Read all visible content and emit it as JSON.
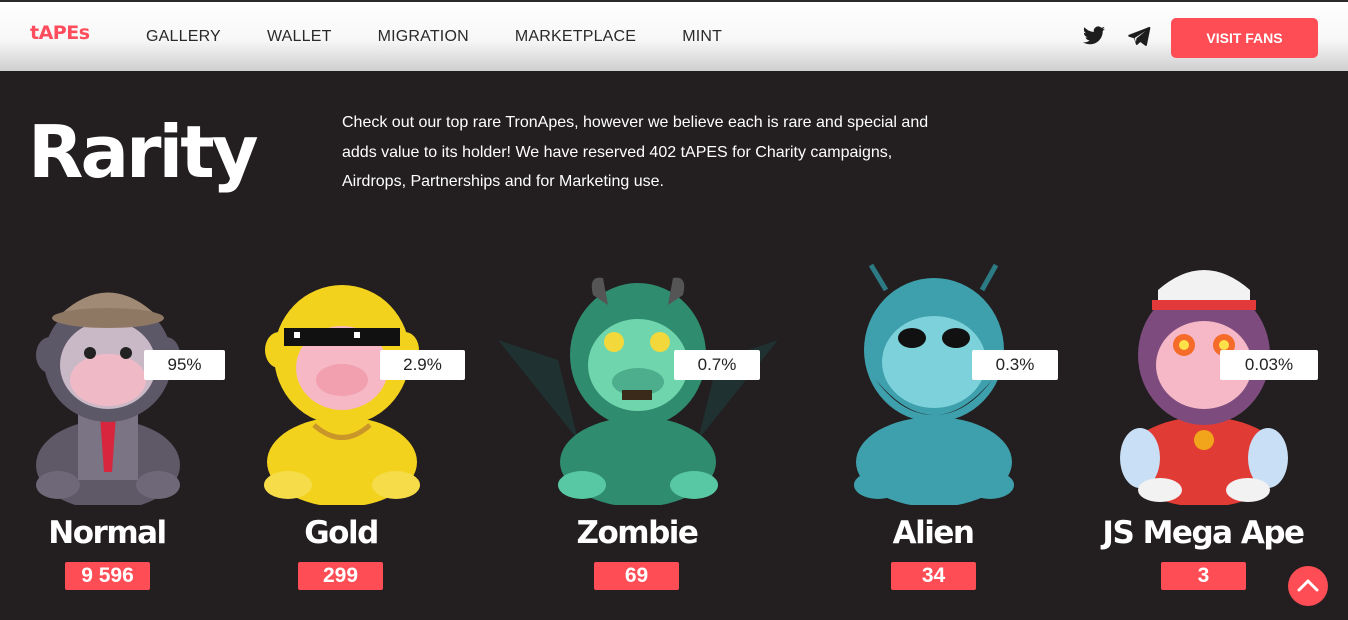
{
  "brand": {
    "logo": "tAPEs",
    "accent": "#ff4d55"
  },
  "nav": {
    "links": [
      "GALLERY",
      "WALLET",
      "MIGRATION",
      "MARKETPLACE",
      "MINT"
    ],
    "social": [
      "twitter-icon",
      "telegram-icon"
    ],
    "cta": "VISIT FANS"
  },
  "hero": {
    "title": "Rarity",
    "description": "Check out our top rare TronApes, however we believe each is rare and special and adds value to its holder! We have reserved 402 tAPES for Charity campaigns, Airdrops, Partnerships and for Marketing use."
  },
  "apes": [
    {
      "name": "Normal",
      "percent": "95%",
      "count": "9 596",
      "color": "#6f6879"
    },
    {
      "name": "Gold",
      "percent": "2.9%",
      "count": "299",
      "color": "#f3d21e"
    },
    {
      "name": "Zombie",
      "percent": "0.7%",
      "count": "69",
      "color": "#2f8c6e"
    },
    {
      "name": "Alien",
      "percent": "0.3%",
      "count": "34",
      "color": "#3ea0ac"
    },
    {
      "name": "JS Mega Ape",
      "percent": "0.03%",
      "count": "3",
      "color": "#7e4b7e"
    }
  ]
}
